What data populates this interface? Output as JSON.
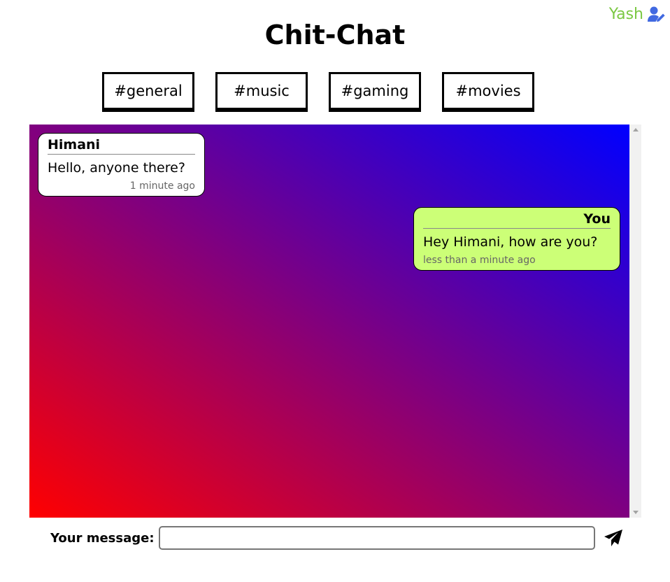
{
  "header": {
    "title": "Chit-Chat",
    "username": "Yash",
    "username_color": "#7bc843",
    "user_icon": "user-edit-icon"
  },
  "channels": [
    {
      "label": "#general"
    },
    {
      "label": "#music"
    },
    {
      "label": "#gaming"
    },
    {
      "label": "#movies"
    }
  ],
  "chat": {
    "background_gradient": [
      "#ff0000",
      "#0000ff"
    ],
    "messages": [
      {
        "sender": "Himani",
        "text": "Hello, anyone there?",
        "time": "1 minute ago",
        "direction": "incoming",
        "bubble_color": "#ffffff"
      },
      {
        "sender": "You",
        "text": "Hey Himani, how are you?",
        "time": "less than a minute ago",
        "direction": "outgoing",
        "bubble_color": "#ccff77"
      }
    ]
  },
  "composer": {
    "label": "Your message:",
    "value": "",
    "placeholder": "",
    "send_icon": "send-icon"
  }
}
